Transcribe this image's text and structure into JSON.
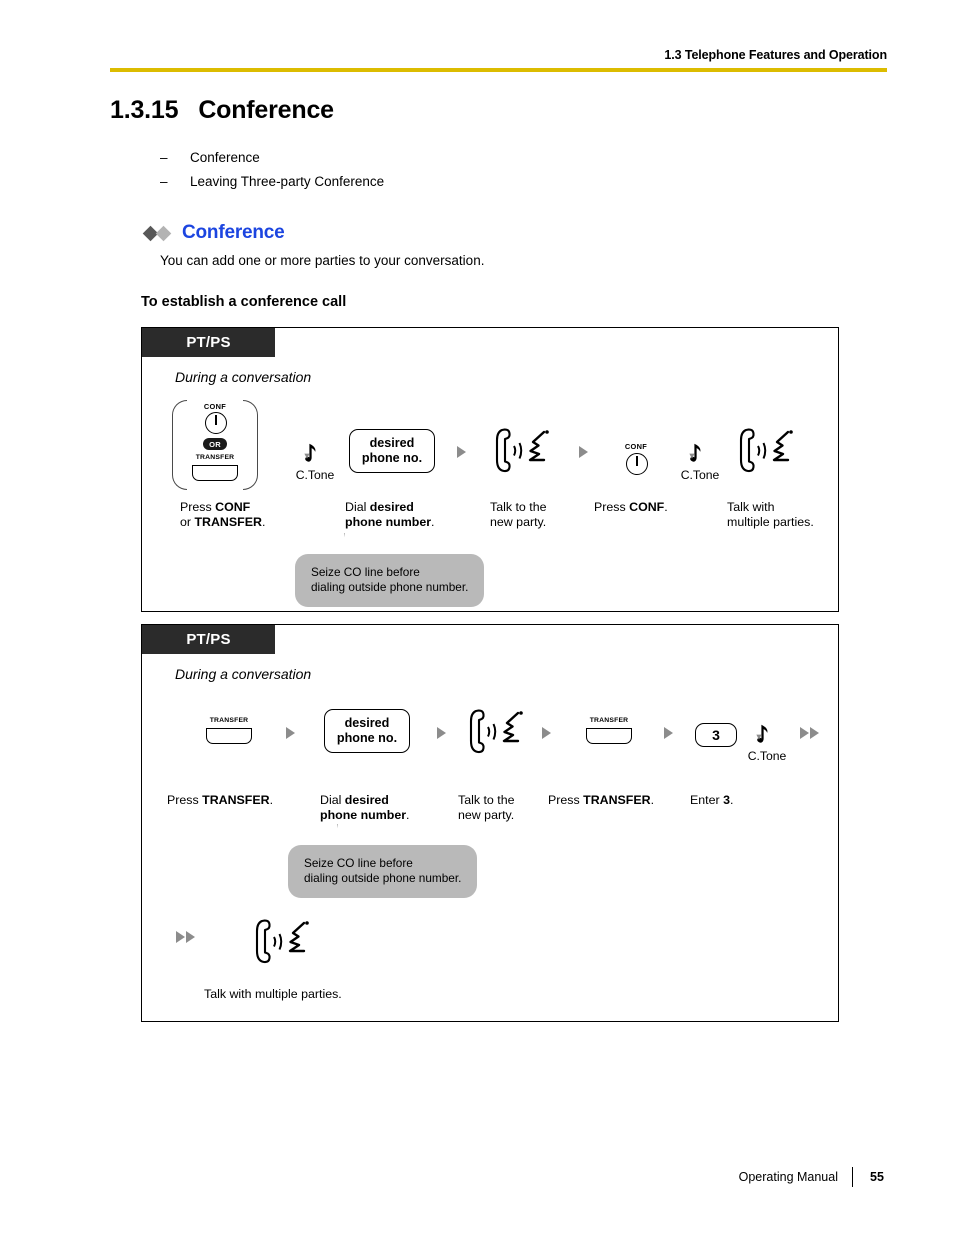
{
  "header": {
    "running_head": "1.3 Telephone Features and Operation",
    "rule_color": "#dcbc00"
  },
  "section": {
    "number": "1.3.15",
    "title": "Conference"
  },
  "topics": [
    {
      "dash": "–",
      "label": "Conference"
    },
    {
      "dash": "–",
      "label": "Leaving Three-party Conference"
    }
  ],
  "subsection": {
    "heading": "Conference",
    "heading_color": "#1c45e0",
    "description": "You can add one or more parties to your conversation.",
    "procedure_heading": "To establish a conference call"
  },
  "procedures": [
    {
      "badge": "PT/PS",
      "context": "During a conversation",
      "steps": [
        {
          "icon": "phone-keys-conf-or-transfer",
          "key_labels": {
            "conf": "CONF",
            "or": "OR",
            "transfer": "TRANSFER"
          },
          "caption_lines": [
            "Press CONF",
            "or TRANSFER."
          ]
        },
        {
          "icon": "confirmation-tone-note",
          "tone_label": "C.Tone",
          "caption_lines": []
        },
        {
          "icon": "dial-entry-box",
          "box_lines": [
            "desired",
            "phone no."
          ],
          "caption_lines": [
            "Dial desired",
            "phone number."
          ]
        },
        {
          "icon": "arrow-right",
          "caption_lines": []
        },
        {
          "icon": "talking-handset",
          "caption_lines": [
            "Talk to the",
            "new party."
          ]
        },
        {
          "icon": "arrow-right",
          "caption_lines": []
        },
        {
          "icon": "conf-key",
          "key_labels": {
            "conf": "CONF"
          },
          "caption_lines": [
            "Press CONF."
          ]
        },
        {
          "icon": "confirmation-tone-note",
          "tone_label": "C.Tone",
          "caption_lines": []
        },
        {
          "icon": "talking-handset",
          "caption_lines": [
            "Talk with",
            "multiple parties."
          ]
        }
      ],
      "callout": {
        "lines": [
          "Seize CO line before",
          "dialing outside phone number."
        ],
        "background": "#b9b9b9"
      }
    },
    {
      "badge": "PT/PS",
      "context": "During a conversation",
      "steps": [
        {
          "icon": "transfer-key",
          "key_labels": {
            "transfer": "TRANSFER"
          },
          "caption_lines": [
            "Press TRANSFER."
          ]
        },
        {
          "icon": "arrow-right",
          "caption_lines": []
        },
        {
          "icon": "dial-entry-box",
          "box_lines": [
            "desired",
            "phone no."
          ],
          "caption_lines": [
            "Dial desired",
            "phone number."
          ]
        },
        {
          "icon": "arrow-right",
          "caption_lines": []
        },
        {
          "icon": "talking-handset",
          "caption_lines": [
            "Talk to the",
            "new party."
          ]
        },
        {
          "icon": "arrow-right",
          "caption_lines": []
        },
        {
          "icon": "transfer-key",
          "key_labels": {
            "transfer": "TRANSFER"
          },
          "caption_lines": [
            "Press TRANSFER."
          ]
        },
        {
          "icon": "arrow-right",
          "caption_lines": []
        },
        {
          "icon": "numeric-key",
          "key_value": "3",
          "caption_lines": [
            "Enter 3."
          ]
        },
        {
          "icon": "confirmation-tone-note",
          "tone_label": "C.Tone",
          "caption_lines": []
        },
        {
          "icon": "arrow-right-double",
          "caption_lines": []
        }
      ],
      "continuation": {
        "icon": "arrow-right-double",
        "result_icon": "talking-handset",
        "caption": "Talk with multiple parties."
      },
      "callout": {
        "lines": [
          "Seize CO line before",
          "dialing outside phone number."
        ],
        "background": "#b9b9b9"
      }
    }
  ],
  "footer": {
    "manual": "Operating Manual",
    "page": "55"
  },
  "captions": {
    "b1_s1_l1_pre": "Press ",
    "b1_s1_l1_b": "CONF",
    "b1_s1_l2_pre": "or ",
    "b1_s1_l2_b": "TRANSFER",
    "b1_s1_l2_post": ".",
    "dial_l1_pre": "Dial ",
    "dial_l1_b": "desired",
    "dial_l2_b": "phone number",
    "dial_l2_post": ".",
    "talk_new_l1": "Talk to the",
    "talk_new_l2": "new party.",
    "press_conf_pre": "Press ",
    "press_conf_b": "CONF",
    "press_conf_post": ".",
    "talk_multi_l1": "Talk with",
    "talk_multi_l2": "multiple parties.",
    "press_transfer_pre": "Press ",
    "press_transfer_b": "TRANSFER",
    "press_transfer_post": ".",
    "enter_pre": "Enter ",
    "enter_b": "3",
    "enter_post": ".",
    "talk_multi_full": "Talk with multiple parties."
  }
}
